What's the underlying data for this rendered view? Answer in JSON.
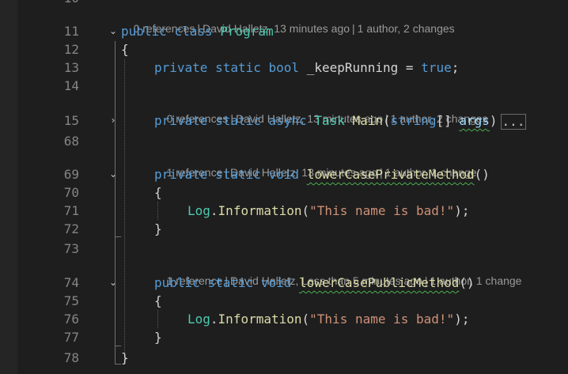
{
  "editor": {
    "top_partial_line": "10",
    "lens": {
      "program_class": [
        "0 references",
        "David Halletz, 13 minutes ago",
        "1 author, 2 changes"
      ],
      "main_method": [
        "0 references",
        "David Halletz, 13 minutes ago",
        "1 author, 2 changes"
      ],
      "private_method": [
        "1 reference",
        "David Halletz, 13 minutes ago",
        "1 author, 1 change"
      ],
      "public_method": [
        "1 reference",
        "David Halletz, Less than 5 minutes ago",
        "1 author, 1 change"
      ]
    },
    "line_numbers": {
      "l11": "11",
      "l12": "12",
      "l13": "13",
      "l14": "14",
      "l15": "15",
      "l68": "68",
      "l69": "69",
      "l70": "70",
      "l71": "71",
      "l72": "72",
      "l73": "73",
      "l74": "74",
      "l75": "75",
      "l76": "76",
      "l77": "77",
      "l78": "78"
    },
    "tokens": {
      "public": "public",
      "class": "class",
      "program": "Program",
      "open_brace": "{",
      "close_brace": "}",
      "private": "private",
      "static": "static",
      "bool": "bool",
      "keep_running": "_keepRunning",
      "assign": " = ",
      "true": "true",
      "semicolon": ";",
      "async": "async",
      "task": "Task",
      "main": "Main",
      "paren_open": "(",
      "string": "string",
      "array_brackets": "[] ",
      "args": "args",
      "paren_close": ")",
      "collapsed_ellipsis": "...",
      "void": "void",
      "lower_private_method": "lowerCasePrivateMethod",
      "lower_public_method": "lowerCasePublicMethod",
      "empty_parens": "()",
      "log": "Log",
      "dot": ".",
      "information": "Information",
      "bad_name_string": "\"This name is bad!\"",
      "close_call": ");"
    }
  }
}
